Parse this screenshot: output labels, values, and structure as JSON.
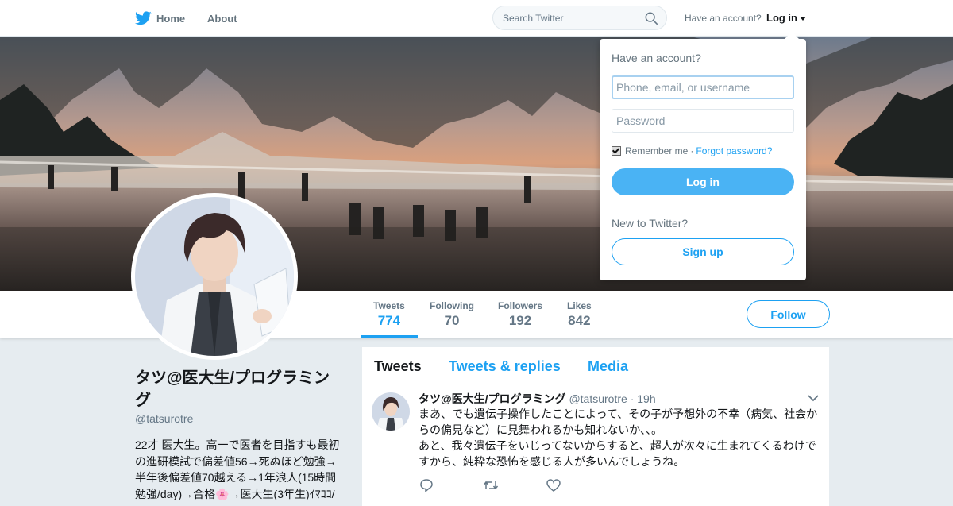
{
  "topbar": {
    "home_label": "Home",
    "about_label": "About",
    "search_placeholder": "Search Twitter",
    "have_account": "Have an account?",
    "login_label": "Log in"
  },
  "colors": {
    "accent": "#1da1f2",
    "button": "#4ab3f4",
    "background": "#e6ecf0"
  },
  "profile": {
    "name": "タツ@医大生/プログラミング",
    "handle": "@tatsurotre",
    "bio": "22才 医大生。高一で医者を目指すも最初の進研模試で偏差値56→死ぬほど勉強→半年後偏差値70越える→1年浪人(15時間勉強/day)→合格🌸→医大生(3年生)ｲﾏｺｺ/"
  },
  "stats": [
    {
      "label": "Tweets",
      "value": "774"
    },
    {
      "label": "Following",
      "value": "70"
    },
    {
      "label": "Followers",
      "value": "192"
    },
    {
      "label": "Likes",
      "value": "842"
    }
  ],
  "follow_label": "Follow",
  "tabs": [
    "Tweets",
    "Tweets & replies",
    "Media"
  ],
  "tweet": {
    "name": "タツ@医大生/プログラミング",
    "handle": "@tatsurotre",
    "sep": "·",
    "time": "19h",
    "line1": "まあ、でも遺伝子操作したことによって、その子が予想外の不幸（病気、社会か",
    "line2": "らの偏見など）に見舞われるかも知れないか、、。",
    "line3": "あと、我々遺伝子をいじってないからすると、超人が次々に生まれてくるわけで",
    "line4": "すから、純粋な恐怖を感じる人が多いんでしょうね。"
  },
  "login_dropdown": {
    "title": "Have an account?",
    "username_placeholder": "Phone, email, or username",
    "password_placeholder": "Password",
    "remember_label": "Remember me",
    "dot": "·",
    "forgot_label": "Forgot password?",
    "login_button": "Log in",
    "new_to_twitter": "New to Twitter?",
    "signup_button": "Sign up"
  },
  "icons": [
    "twitter-bird-icon",
    "search-icon",
    "caret-down-icon",
    "chevron-down-icon",
    "reply-icon",
    "retweet-icon",
    "like-icon"
  ]
}
